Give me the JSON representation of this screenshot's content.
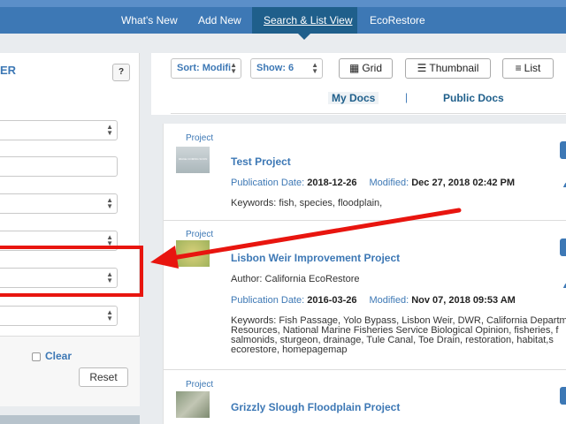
{
  "nav": {
    "items": [
      "What's New",
      "Add New",
      "Search & List View",
      "EcoRestore"
    ],
    "active_index": 2
  },
  "filter": {
    "title_partial": "ER",
    "help": "?",
    "clear": "Clear",
    "reset": "Reset"
  },
  "toolbar": {
    "sort": "Sort: Modifi",
    "show": "Show: 6",
    "grid": "Grid",
    "thumbnail": "Thumbnail",
    "list": "List",
    "my_docs": "My Docs",
    "separator": "|",
    "public_docs": "Public Docs"
  },
  "results": [
    {
      "tag": "Project",
      "thumb_text": "IMAGE COMING SOON",
      "title": "Test Project",
      "pub_label": "Publication Date:",
      "pub_value": "2018-12-26",
      "mod_label": "Modified:",
      "mod_value": "Dec 27, 2018 02:42 PM",
      "keywords": [
        "Keywords: fish, species, floodplain,"
      ]
    },
    {
      "tag": "Project",
      "title": "Lisbon Weir Improvement Project",
      "author": "Author: California EcoRestore",
      "pub_label": "Publication Date:",
      "pub_value": "2016-03-26",
      "mod_label": "Modified:",
      "mod_value": "Nov 07, 2018 09:53 AM",
      "keywords": [
        "Keywords: Fish Passage, Yolo Bypass, Lisbon Weir, DWR, California Departm",
        "Resources, National Marine Fisheries Service Biological Opinion, fisheries, f",
        "salmonids, sturgeon, drainage, Tule Canal, Toe Drain, restoration, habitat,s",
        "ecorestore, homepagemap"
      ]
    },
    {
      "tag": "Project",
      "title": "Grizzly Slough Floodplain Project"
    }
  ],
  "colors": {
    "brand": "#3d78b5",
    "nav_active": "#1f5f8b",
    "highlight": "#e8150f"
  }
}
